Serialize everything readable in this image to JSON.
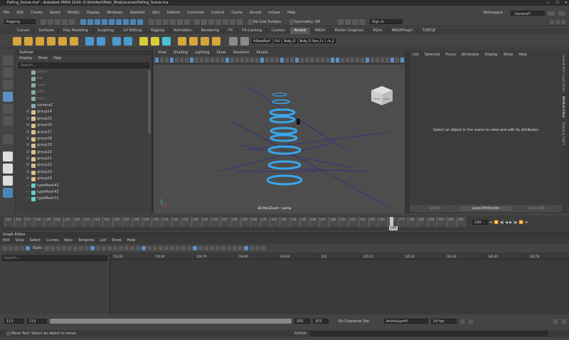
{
  "window": {
    "title": "Falling_Scene.ma* - Autodesk MAYA 2024: D:\\Artefact\\Main_Body\\scenes\\Falling_Scene.ma"
  },
  "menubar": {
    "items": [
      "File",
      "Edit",
      "Create",
      "Select",
      "Modify",
      "Display",
      "Windows",
      "Skeleton",
      "Skin",
      "Deform",
      "Constrain",
      "Control",
      "Cache",
      "Arnold",
      "mGear",
      "Help"
    ],
    "workspace_label": "Workspace :",
    "workspace_value": "General*"
  },
  "statusline": {
    "menu_set": "Rigging",
    "live_surface": "No Live Surface",
    "symmetry": "Symmetry: Off",
    "sign_in": "Sign In"
  },
  "shelf_tabs": [
    "Curves",
    "Surfaces",
    "Poly Modeling",
    "Sculpting",
    "UV Editing",
    "Rigging",
    "Animation",
    "Rendering",
    "FX",
    "FX Caching",
    "Custom",
    "Arnold",
    "MASH",
    "Motion Graphics",
    "XGen",
    "MASHPlugin",
    "TURTLE"
  ],
  "shelf_active": "Arnold",
  "outliner": {
    "title": "Outliner",
    "menu": [
      "Display",
      "Show",
      "Help"
    ],
    "search_placeholder": "Search...",
    "items": [
      {
        "label": "persp",
        "type": "cam",
        "dim": true
      },
      {
        "label": "top",
        "type": "cam",
        "dim": true
      },
      {
        "label": "front",
        "type": "cam",
        "dim": true
      },
      {
        "label": "side",
        "type": "cam",
        "dim": true
      },
      {
        "label": "ltenn",
        "type": "cam",
        "dim": true
      },
      {
        "label": "camera2",
        "type": "cam",
        "dim": false
      },
      {
        "label": "group14",
        "type": "grp",
        "dim": false
      },
      {
        "label": "group15",
        "type": "grp",
        "dim": false
      },
      {
        "label": "group16",
        "type": "grp",
        "dim": false
      },
      {
        "label": "group17",
        "type": "grp",
        "dim": false
      },
      {
        "label": "group18",
        "type": "grp",
        "dim": false
      },
      {
        "label": "group19",
        "type": "grp",
        "dim": false
      },
      {
        "label": "group20",
        "type": "grp",
        "dim": false
      },
      {
        "label": "group21",
        "type": "grp",
        "dim": false
      },
      {
        "label": "group22",
        "type": "grp",
        "dim": false
      },
      {
        "label": "group23",
        "type": "grp",
        "dim": false
      },
      {
        "label": "group24",
        "type": "grp",
        "dim": false
      },
      {
        "label": "typeMesh42",
        "type": "mesh",
        "dim": false
      },
      {
        "label": "typeMesh43",
        "type": "mesh",
        "dim": false
      },
      {
        "label": "typeMesh71",
        "type": "mesh",
        "dim": false
      }
    ]
  },
  "viewport": {
    "menu": [
      "View",
      "Shading",
      "Lighting",
      "Show",
      "Renderer",
      "Panels"
    ],
    "label": "2D Pan/Zoom : persp",
    "viewcube_front": "FRONT",
    "viewcube_right": "RIGHT"
  },
  "arnold_shelf": {
    "labels": [
      "AiStandSurf",
      "Ch2",
      "Body_Cl",
      "Body_Cl Face_Cr",
      "ch_2"
    ]
  },
  "attribute_editor": {
    "menu": [
      "List",
      "Selected",
      "Focus",
      "Attributes",
      "Display",
      "Show",
      "Help"
    ],
    "message": "Select an object in the scene to view and edit its attributes",
    "buttons": [
      "Select",
      "Load Attributes",
      "Copy Tab"
    ],
    "side_tabs": [
      "Channel Box / Layer Editor",
      "Attribute Editor",
      "Modeling Toolkit"
    ]
  },
  "timeslider": {
    "ticks": [
      "115",
      "116",
      "117",
      "118",
      "119",
      "120",
      "121",
      "122",
      "123",
      "124",
      "125",
      "126",
      "127",
      "128",
      "129",
      "130",
      "131",
      "132",
      "133",
      "134",
      "135",
      "136",
      "137",
      "138",
      "139",
      "140",
      "141",
      "142",
      "143",
      "144",
      "145",
      "146",
      "147",
      "148",
      "149",
      "150",
      "155",
      "160",
      "165",
      "170",
      "175",
      "180",
      "185",
      "190",
      "195",
      "200",
      "205"
    ],
    "current_frame": "190",
    "field": "190"
  },
  "graph_editor": {
    "title": "Graph Editor",
    "menu": [
      "Edit",
      "View",
      "Select",
      "Curves",
      "Keys",
      "Tangents",
      "List",
      "Show",
      "Help"
    ],
    "stats_label": "Stats",
    "search_placeholder": "Search...",
    "ruler": [
      "119.50",
      "119.60",
      "119.70",
      "119.80",
      "119.90",
      "120",
      "120.10",
      "120.20",
      "120.30",
      "120.40",
      "120.50"
    ]
  },
  "range": {
    "start": "115",
    "inner_start": "115",
    "inner_end": "205",
    "end": "205",
    "character_set": "No Character Set",
    "anim_layer": "AnimLayer8",
    "fps": "24 fps"
  },
  "helpline": {
    "text": "Move Tool: Select an object to move.",
    "script_lang": "Python"
  }
}
